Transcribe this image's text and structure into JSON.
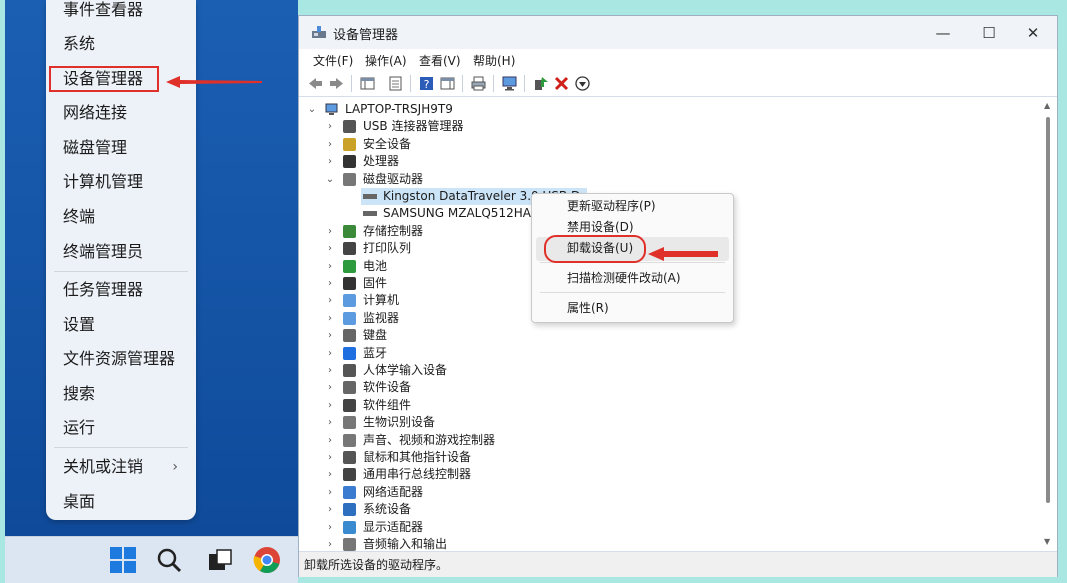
{
  "winx_menu": {
    "items": [
      {
        "label": "事件查看器"
      },
      {
        "label": "系统"
      },
      {
        "label": "设备管理器"
      },
      {
        "label": "网络连接"
      },
      {
        "label": "磁盘管理"
      },
      {
        "label": "计算机管理"
      },
      {
        "label": "终端"
      },
      {
        "label": "终端管理员"
      },
      {
        "label": "任务管理器"
      },
      {
        "label": "设置"
      },
      {
        "label": "文件资源管理器"
      },
      {
        "label": "搜索"
      },
      {
        "label": "运行"
      },
      {
        "label": "关机或注销"
      },
      {
        "label": "桌面"
      }
    ],
    "chevron": "›"
  },
  "window": {
    "title": "设备管理器",
    "controls": {
      "minimize": "—",
      "maximize": "☐",
      "close": "✕"
    }
  },
  "menubar": [
    "文件(F)",
    "操作(A)",
    "查看(V)",
    "帮助(H)"
  ],
  "tree": {
    "root": "LAPTOP-TRSJH9T9",
    "nodes": [
      {
        "label": "USB 连接器管理器",
        "icon": "usb-icon"
      },
      {
        "label": "安全设备",
        "icon": "security-key-icon"
      },
      {
        "label": "处理器",
        "icon": "processor-icon"
      },
      {
        "label": "磁盘驱动器",
        "icon": "disk-drive-icon",
        "expanded": true,
        "children": [
          "Kingston DataTraveler 3.0 USB Device",
          "SAMSUNG MZALQ512HALU"
        ]
      },
      {
        "label": "存储控制器",
        "icon": "storage-controller-icon"
      },
      {
        "label": "打印队列",
        "icon": "printer-icon"
      },
      {
        "label": "电池",
        "icon": "battery-icon"
      },
      {
        "label": "固件",
        "icon": "firmware-icon"
      },
      {
        "label": "计算机",
        "icon": "computer-icon"
      },
      {
        "label": "监视器",
        "icon": "monitor-icon"
      },
      {
        "label": "键盘",
        "icon": "keyboard-icon"
      },
      {
        "label": "蓝牙",
        "icon": "bluetooth-icon"
      },
      {
        "label": "人体学输入设备",
        "icon": "hid-icon"
      },
      {
        "label": "软件设备",
        "icon": "software-device-icon"
      },
      {
        "label": "软件组件",
        "icon": "software-component-icon"
      },
      {
        "label": "生物识别设备",
        "icon": "fingerprint-icon"
      },
      {
        "label": "声音、视频和游戏控制器",
        "icon": "speaker-icon"
      },
      {
        "label": "鼠标和其他指针设备",
        "icon": "mouse-icon"
      },
      {
        "label": "通用串行总线控制器",
        "icon": "usb-controller-icon"
      },
      {
        "label": "网络适配器",
        "icon": "network-adapter-icon"
      },
      {
        "label": "系统设备",
        "icon": "system-device-icon"
      },
      {
        "label": "显示适配器",
        "icon": "display-adapter-icon"
      },
      {
        "label": "音频输入和输出",
        "icon": "audio-io-icon"
      }
    ]
  },
  "context_menu": [
    "更新驱动程序(P)",
    "禁用设备(D)",
    "卸载设备(U)",
    "扫描检测硬件改动(A)",
    "属性(R)"
  ],
  "status_bar": "卸载所选设备的驱动程序。",
  "colors": {
    "annotation_red": "#e0302a",
    "desktop_blue": "#1b5fb3",
    "page_bg": "#a9e8e2"
  }
}
